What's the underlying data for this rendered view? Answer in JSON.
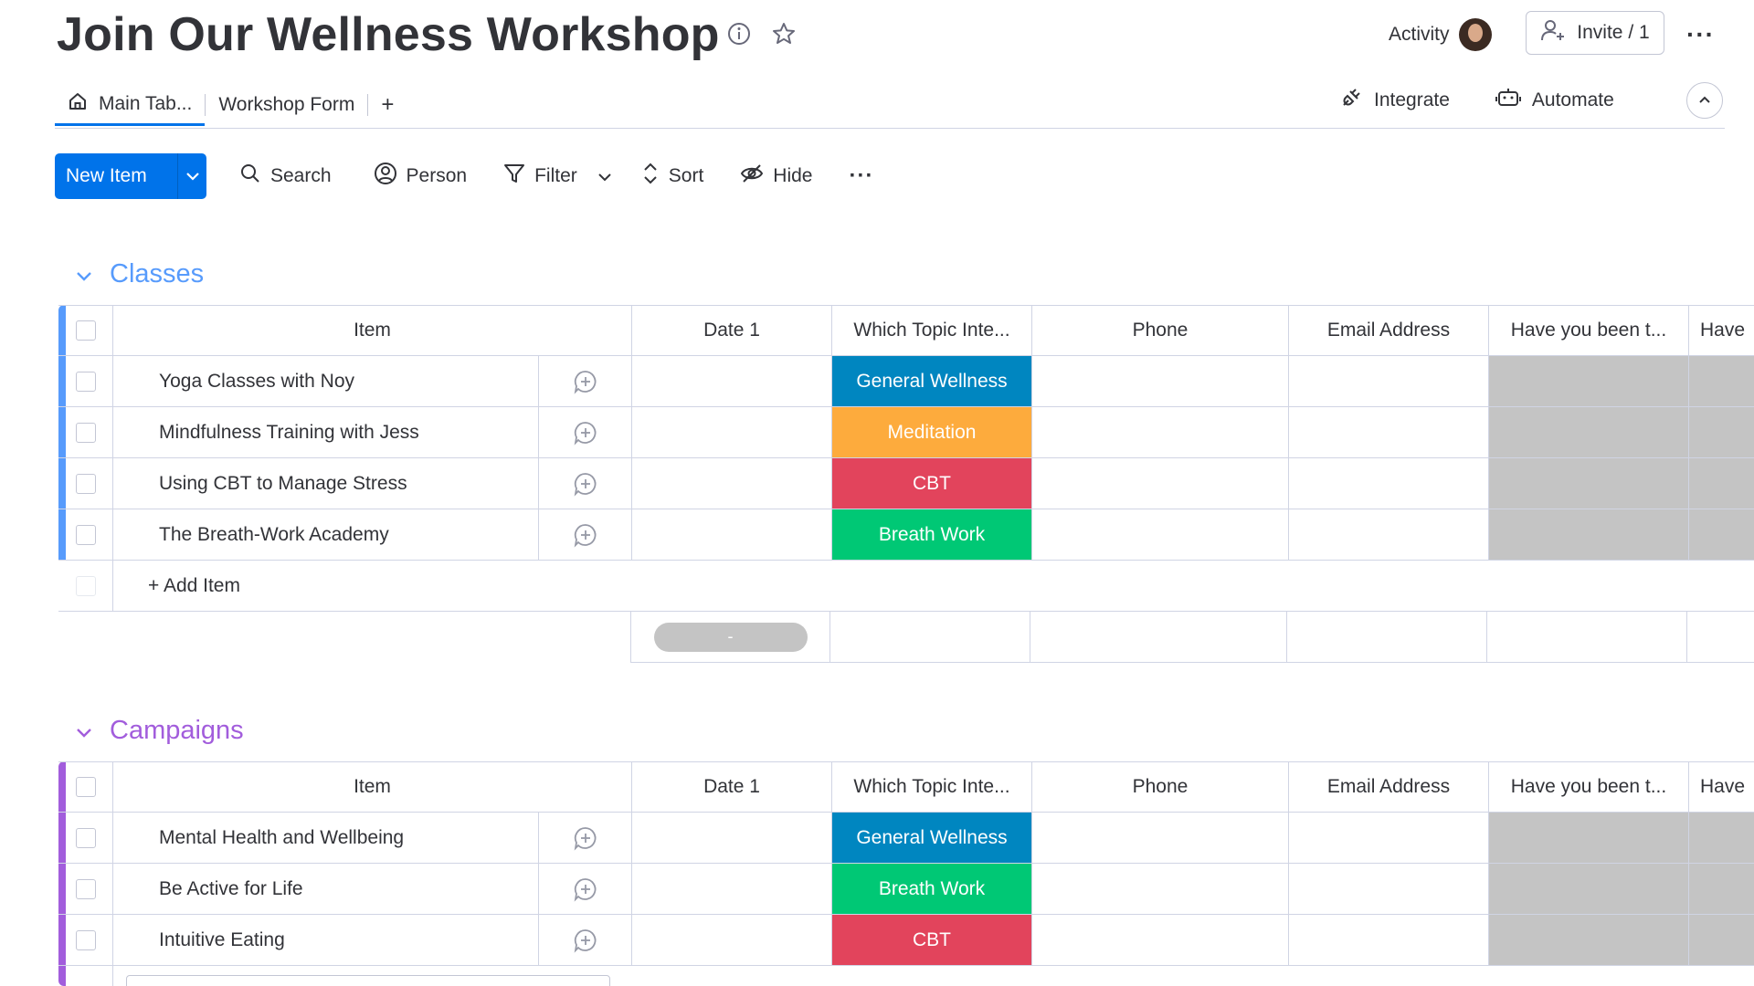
{
  "board": {
    "title": "Join Our Wellness Workshop",
    "activity_label": "Activity",
    "invite_label": "Invite / 1"
  },
  "tabs": [
    {
      "label": "Main Tab..."
    },
    {
      "label": "Workshop Form"
    },
    {
      "label": "+"
    }
  ],
  "header_actions": {
    "integrate": "Integrate",
    "automate": "Automate"
  },
  "toolbar": {
    "new_item": "New Item",
    "search": "Search",
    "person": "Person",
    "filter": "Filter",
    "sort": "Sort",
    "hide": "Hide"
  },
  "columns": {
    "item": "Item",
    "date": "Date 1",
    "topic": "Which Topic Inte...",
    "phone": "Phone",
    "email": "Email Address",
    "been": "Have you been t...",
    "have": "Have"
  },
  "colors": {
    "accent": "#0073ea",
    "classes": "#579bfc",
    "campaigns": "#a25ddc",
    "general_wellness": "#0086c0",
    "meditation": "#fdab3d",
    "cbt": "#e2445c",
    "breath_work": "#00c875"
  },
  "groups": [
    {
      "name": "Classes",
      "add_item": "+ Add Item",
      "summary_value": "-",
      "rows": [
        {
          "name": "Yoga Classes with Noy",
          "topic": "General Wellness"
        },
        {
          "name": "Mindfulness Training with Jess",
          "topic": "Meditation"
        },
        {
          "name": "Using CBT to Manage Stress",
          "topic": "CBT"
        },
        {
          "name": "The Breath-Work Academy",
          "topic": "Breath Work"
        }
      ]
    },
    {
      "name": "Campaigns",
      "rows": [
        {
          "name": "Mental Health and Wellbeing",
          "topic": "General Wellness"
        },
        {
          "name": "Be Active for Life",
          "topic": "Breath Work"
        },
        {
          "name": "Intuitive Eating",
          "topic": "CBT"
        }
      ]
    }
  ]
}
